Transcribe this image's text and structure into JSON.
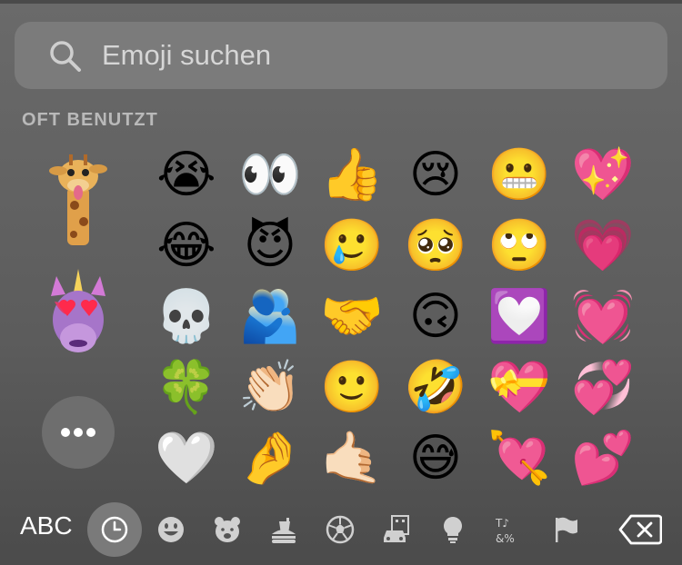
{
  "search": {
    "placeholder": "Emoji suchen",
    "icon": "magnifier-icon"
  },
  "section_title": "OFT BENUTZT",
  "memoji": [
    {
      "name": "giraffe-memoji"
    },
    {
      "name": "unicorn-heart-eyes-memoji"
    }
  ],
  "more_button": {
    "icon": "ellipsis-icon"
  },
  "emoji_grid": [
    [
      "😭",
      "👀",
      "👍",
      "😢",
      "😬",
      "💖"
    ],
    [
      "😂",
      "😈",
      "🥲",
      "🥺",
      "🙄",
      "💗"
    ],
    [
      "💀",
      "🫂",
      "🤝",
      "🙃",
      "💟",
      "💓"
    ],
    [
      "🍀",
      "👏🏻",
      "🙂",
      "🤣",
      "💝",
      "💞"
    ],
    [
      "🤍",
      "🤌",
      "🤙🏻",
      "😅",
      "💘",
      "💕"
    ]
  ],
  "toolbar": {
    "abc_label": "ABC",
    "categories": [
      {
        "name": "recent",
        "icon": "clock-icon",
        "selected": true
      },
      {
        "name": "smileys",
        "icon": "smiley-icon"
      },
      {
        "name": "animals",
        "icon": "bear-icon"
      },
      {
        "name": "food",
        "icon": "burger-drink-icon"
      },
      {
        "name": "activity",
        "icon": "soccer-ball-icon"
      },
      {
        "name": "travel",
        "icon": "car-building-icon"
      },
      {
        "name": "objects",
        "icon": "lightbulb-icon"
      },
      {
        "name": "symbols",
        "icon": "symbols-icon"
      },
      {
        "name": "flags",
        "icon": "flag-icon"
      }
    ],
    "delete_icon": "backspace-icon"
  }
}
